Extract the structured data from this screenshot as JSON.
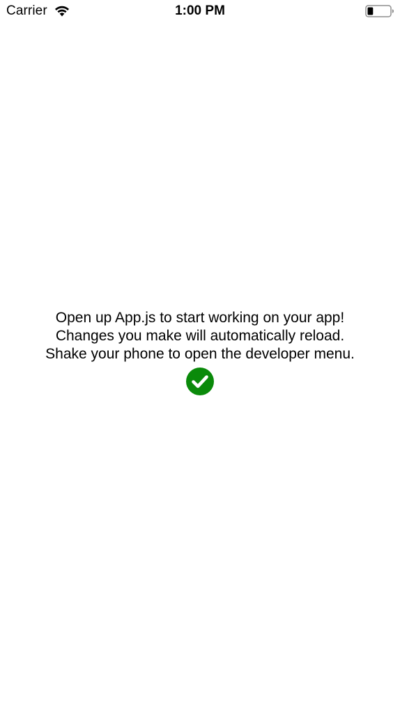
{
  "status_bar": {
    "carrier": "Carrier",
    "time": "1:00 PM",
    "signal_icon": "wifi-icon",
    "battery_icon": "battery-icon",
    "battery_level": 0.25
  },
  "main": {
    "lines": [
      "Open up App.js to start working on your app!",
      "Changes you make will automatically reload.",
      "Shake your phone to open the developer menu."
    ],
    "status_icon": "check-circle-icon",
    "status_color": "#0a8a0a"
  }
}
